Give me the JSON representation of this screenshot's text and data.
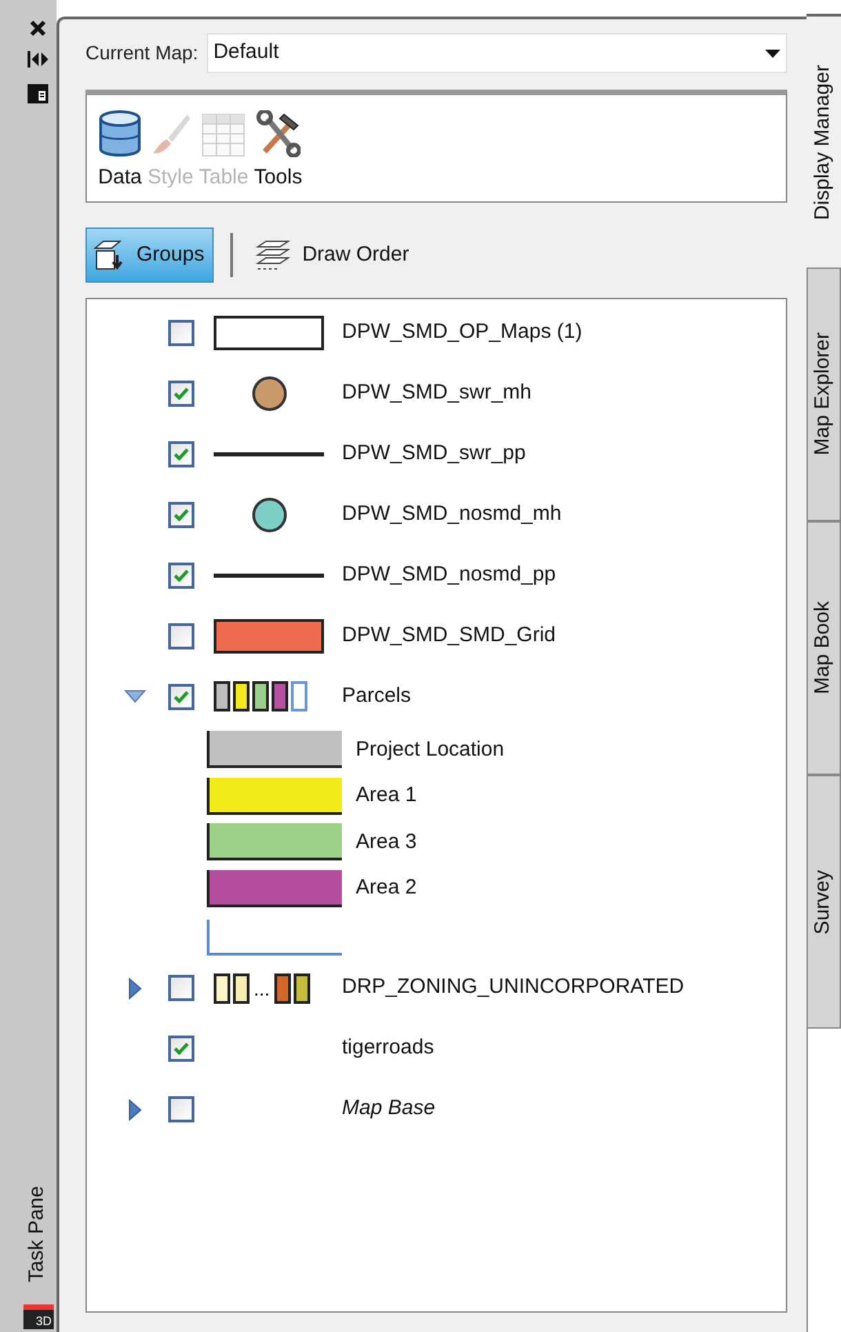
{
  "side_strip": {
    "label": "Task Pane",
    "badge": "3D"
  },
  "current_map": {
    "label": "Current Map:",
    "value": "Default"
  },
  "toolbar": [
    {
      "kind": "data",
      "label": "Data",
      "disabled": false
    },
    {
      "kind": "style",
      "label": "Style",
      "disabled": true
    },
    {
      "kind": "table",
      "label": "Table",
      "disabled": true
    },
    {
      "kind": "tools",
      "label": "Tools",
      "disabled": false
    }
  ],
  "view_buttons": [
    {
      "kind": "groups",
      "label": "Groups",
      "selected": true
    },
    {
      "kind": "draw_order",
      "label": "Draw Order",
      "selected": false
    }
  ],
  "layers": [
    {
      "kind": "box",
      "label": "DPW_SMD_OP_Maps (1)",
      "checked": false
    },
    {
      "kind": "point",
      "color": "#c99a6b",
      "label": "DPW_SMD_swr_mh",
      "checked": true
    },
    {
      "kind": "line",
      "label": "DPW_SMD_swr_pp",
      "checked": true
    },
    {
      "kind": "point",
      "color": "#7ecfc8",
      "label": "DPW_SMD_nosmd_mh",
      "checked": true
    },
    {
      "kind": "line",
      "label": "DPW_SMD_nosmd_pp",
      "checked": true
    },
    {
      "kind": "fill",
      "color": "#ef6b4d",
      "label": "DPW_SMD_SMD_Grid",
      "checked": false
    },
    {
      "kind": "theme",
      "swatches": [
        {
          "color": "#bdbdbd"
        },
        {
          "color": "#f2ea1c"
        },
        {
          "color": "#9bd08a"
        },
        {
          "color": "#b84f9f"
        }
      ],
      "label": "Parcels",
      "checked": true,
      "expanded": true,
      "children": [
        {
          "kind": "fill",
          "color": "#c0c0c0",
          "label": "Project Location"
        },
        {
          "kind": "fill",
          "color": "#f4ec1a",
          "label": "Area 1"
        },
        {
          "kind": "fill",
          "color": "#9dd18a",
          "label": "Area 3"
        },
        {
          "kind": "fill",
          "color": "#b64e9e",
          "label": "Area 2"
        },
        {
          "kind": "outline",
          "color": "#5b8bd0"
        }
      ]
    },
    {
      "kind": "theme",
      "swatches": [
        {
          "color": "#fbf4c8"
        },
        {
          "color": "#f7eeb2"
        }
      ],
      "more": "...",
      "tail": [
        {
          "color": "#d26628"
        },
        {
          "color": "#c6bc3c"
        }
      ],
      "label": "DRP_ZONING_UNINCORPORATED",
      "checked": false,
      "expanded": false
    },
    {
      "kind": "none",
      "label": "tigerroads",
      "checked": true
    },
    {
      "kind": "group",
      "label": "Map Base",
      "checked": false,
      "expanded": false
    }
  ],
  "tabs": [
    {
      "label": "Display Manager",
      "selected": true
    },
    {
      "label": "Map Explorer",
      "selected": false
    },
    {
      "label": "Map Book",
      "selected": false
    },
    {
      "label": "Survey",
      "selected": false
    }
  ]
}
